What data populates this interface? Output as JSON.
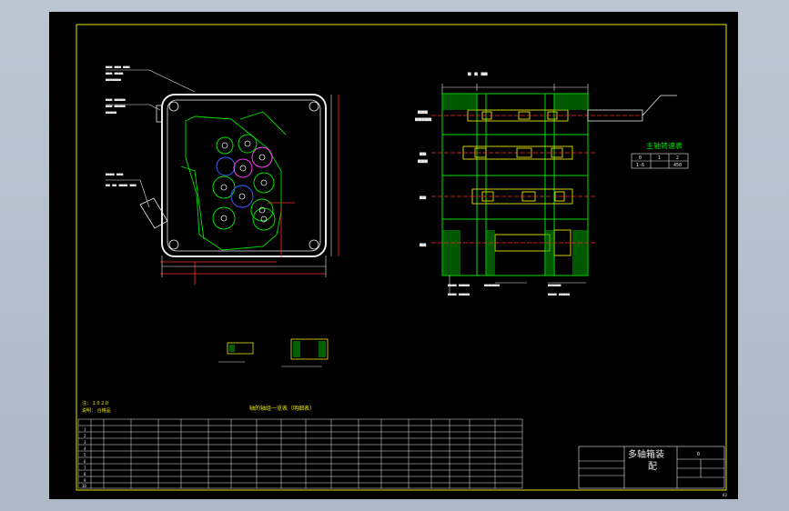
{
  "drawing": {
    "bg_color": "#000000",
    "frame_color": "#e6e600",
    "colors": {
      "yellow": "#e6e600",
      "green": "#00e000",
      "white": "#e8e8e8",
      "red": "#ff2a2a",
      "cyan": "#00e0e0",
      "magenta": "#ff3cff",
      "blue": "#3a5cff"
    }
  },
  "title_block": {
    "title_line1": "多轴箱装",
    "title_line2": "配",
    "small_label": "0"
  },
  "speed_table": {
    "title": "主轴转速表",
    "headers": [
      "0",
      "1",
      "2"
    ],
    "values": [
      "1-6",
      "0",
      "450"
    ]
  },
  "parts_table": {
    "title": "轴的轴组一览表（明细表）",
    "notes_line1": "注：       1.0    2.0",
    "notes_line2": "说明：    合格品",
    "row_numbers": [
      "1",
      "2",
      "3",
      "4",
      "5",
      "6",
      "7",
      "8",
      "9",
      "10"
    ]
  },
  "labels": {
    "corner_mark": "A3"
  }
}
